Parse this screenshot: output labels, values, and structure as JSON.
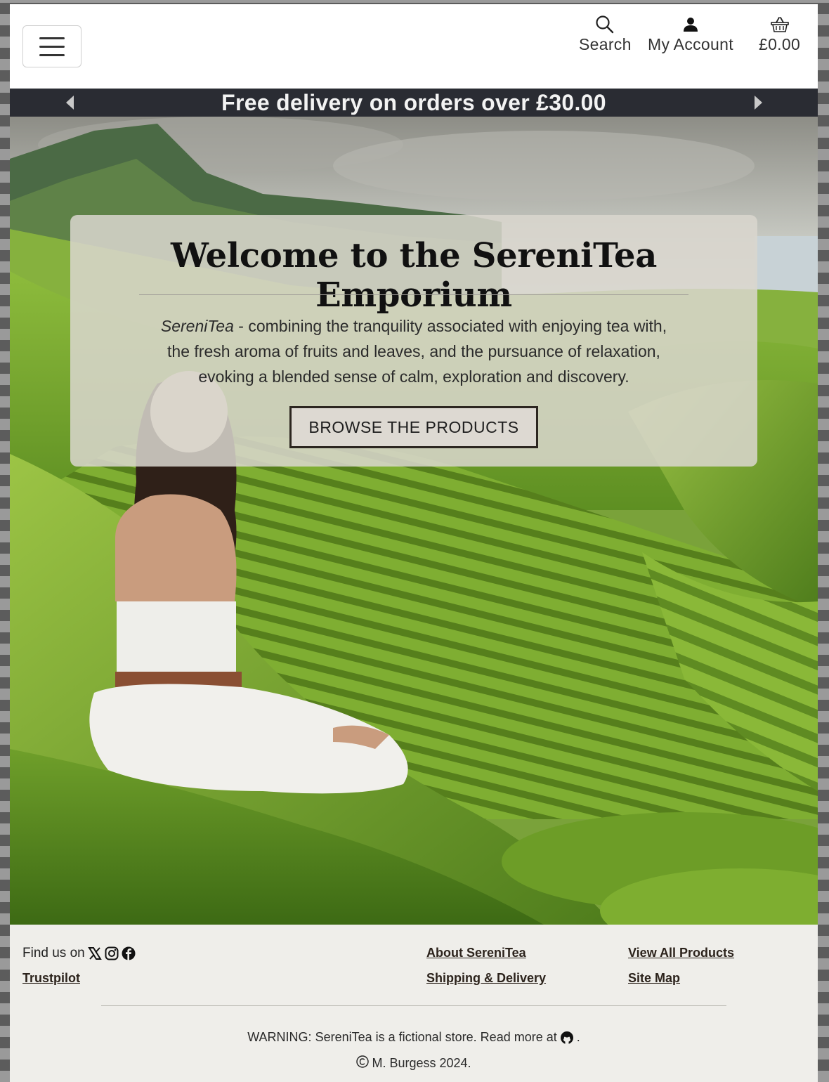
{
  "header": {
    "menu_icon": "hamburger-icon",
    "nav": [
      {
        "label": "Search",
        "icon": "search-icon"
      },
      {
        "label": "My Account",
        "icon": "user-icon"
      },
      {
        "label": "£0.00",
        "icon": "basket-icon"
      }
    ]
  },
  "banner": {
    "message": "Free delivery on orders over £30.00"
  },
  "hero": {
    "title": "Welcome to the SereniTea Emporium",
    "brand_em": "SereniTea",
    "text_line1_rest": " - combining the tranquility associated with enjoying tea with,",
    "text_line2": "the fresh aroma of fruits and leaves, and the pursuance of relaxation,",
    "text_line3": "evoking a blended sense of calm, exploration and discovery.",
    "cta": "BROWSE THE PRODUCTS"
  },
  "footer": {
    "find_us": "Find us on",
    "social_icons": [
      "x-icon",
      "instagram-icon",
      "facebook-icon"
    ],
    "links": {
      "trustpilot": "Trustpilot",
      "about": "About SereniTea",
      "shipping": "Shipping & Delivery",
      "all_products": "View All Products",
      "site_map": "Site Map"
    },
    "warning": "WARNING: SereniTea is a fictional store. Read more at",
    "warning_end": ".",
    "copyright": "M. Burgess 2024."
  },
  "colors": {
    "banner_bg": "#2a2c33",
    "card_bg": "#dad6ce",
    "footer_bg": "#efeeea",
    "link": "#2c231c"
  }
}
